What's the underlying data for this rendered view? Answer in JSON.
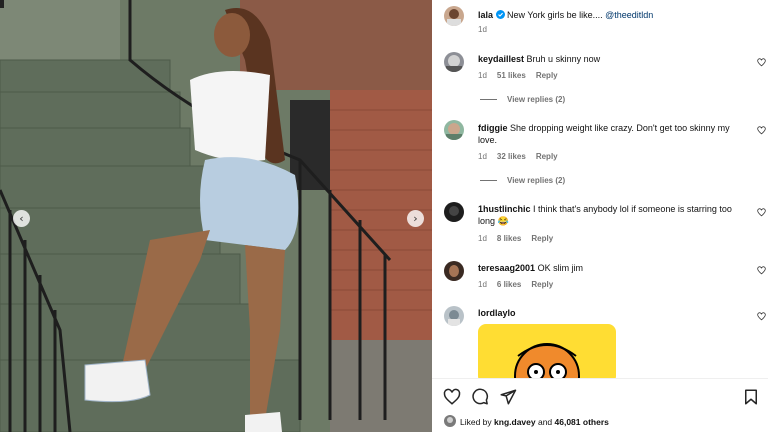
{
  "post": {
    "author": "lala",
    "caption": "New York girls be like.... ",
    "mention": "@theeditldn",
    "time": "1d"
  },
  "comments": [
    {
      "user": "keydaillest",
      "text": "Bruh u skinny now",
      "time": "1d",
      "likes": "51 likes",
      "reply": "Reply",
      "view_replies": "View replies (2)"
    },
    {
      "user": "fdiggie",
      "text": "She dropping weight like crazy. Don't get too skinny my love.",
      "time": "1d",
      "likes": "32 likes",
      "reply": "Reply",
      "view_replies": "View replies (2)"
    },
    {
      "user": "1hustlinchic",
      "text": "I think that's anybody lol if someone is starring too long 😂",
      "time": "1d",
      "likes": "8 likes",
      "reply": "Reply"
    },
    {
      "user": "teresaag2001",
      "text": "OK slim jim",
      "time": "1d",
      "likes": "6 likes",
      "reply": "Reply"
    },
    {
      "user": "lordlaylo"
    }
  ],
  "likes_bar": {
    "prefix": "Liked by ",
    "user": "kng.davey",
    "middle": " and ",
    "count": "46,081 others"
  },
  "nav": {
    "prev": "‹",
    "next": "›"
  },
  "colors": {
    "accent": "#0095f6",
    "muted": "#737373",
    "sticker": "#ffdd33"
  }
}
